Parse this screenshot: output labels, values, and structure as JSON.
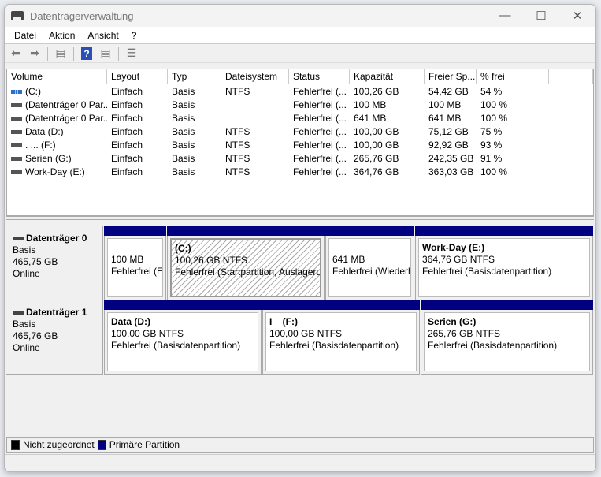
{
  "window": {
    "title": "Datenträgerverwaltung"
  },
  "menu": [
    "Datei",
    "Aktion",
    "Ansicht",
    "?"
  ],
  "toolbar": {
    "icons": [
      "back-arrow-icon",
      "forward-arrow-icon",
      "console-tree-icon",
      "help-icon",
      "action-pane-icon",
      "properties-icon"
    ]
  },
  "table": {
    "columns": [
      "Volume",
      "Layout",
      "Typ",
      "Dateisystem",
      "Status",
      "Kapazität",
      "Freier Sp...",
      "% frei",
      ""
    ],
    "rows": [
      {
        "icon": "c",
        "cells": [
          "(C:)",
          "Einfach",
          "Basis",
          "NTFS",
          "Fehlerfrei (...",
          "100,26 GB",
          "54,42 GB",
          "54 %"
        ]
      },
      {
        "icon": "d",
        "cells": [
          "(Datenträger 0 Par...",
          "Einfach",
          "Basis",
          "",
          "Fehlerfrei (...",
          "100 MB",
          "100 MB",
          "100 %"
        ]
      },
      {
        "icon": "d",
        "cells": [
          "(Datenträger 0 Par...",
          "Einfach",
          "Basis",
          "",
          "Fehlerfrei (...",
          "641 MB",
          "641 MB",
          "100 %"
        ]
      },
      {
        "icon": "d",
        "cells": [
          "Data (D:)",
          "Einfach",
          "Basis",
          "NTFS",
          "Fehlerfrei (...",
          "100,00 GB",
          "75,12 GB",
          "75 %"
        ]
      },
      {
        "icon": "d",
        "cells": [
          ". ...        (F:)",
          "Einfach",
          "Basis",
          "NTFS",
          "Fehlerfrei (...",
          "100,00 GB",
          "92,92 GB",
          "93 %"
        ]
      },
      {
        "icon": "d",
        "cells": [
          "Serien (G:)",
          "Einfach",
          "Basis",
          "NTFS",
          "Fehlerfrei (...",
          "265,76 GB",
          "242,35 GB",
          "91 %"
        ]
      },
      {
        "icon": "d",
        "cells": [
          "Work-Day (E:)",
          "Einfach",
          "Basis",
          "NTFS",
          "Fehlerfrei (...",
          "364,76 GB",
          "363,03 GB",
          "100 %"
        ]
      }
    ]
  },
  "disks": [
    {
      "name": "Datenträger 0",
      "type": "Basis",
      "size": "465,75 GB",
      "state": "Online",
      "partitions": [
        {
          "title": "",
          "size": "100 MB",
          "status": "Fehlerfrei (EFI-Systempartition)"
        },
        {
          "title": "(C:)",
          "size": "100,26 GB NTFS",
          "status": "Fehlerfrei (Startpartition, Auslagerungsdatei)",
          "selected": true
        },
        {
          "title": "",
          "size": "641 MB",
          "status": "Fehlerfrei (Wiederherstellungspartition)"
        },
        {
          "title": "Work-Day  (E:)",
          "size": "364,76 GB NTFS",
          "status": "Fehlerfrei (Basisdatenpartition)"
        }
      ]
    },
    {
      "name": "Datenträger 1",
      "type": "Basis",
      "size": "465,76 GB",
      "state": "Online",
      "partitions": [
        {
          "title": "Data  (D:)",
          "size": "100,00 GB NTFS",
          "status": "Fehlerfrei (Basisdatenpartition)"
        },
        {
          "title": "I      _  (F:)",
          "size": "100,00 GB NTFS",
          "status": "Fehlerfrei (Basisdatenpartition)"
        },
        {
          "title": "Serien  (G:)",
          "size": "265,76 GB NTFS",
          "status": "Fehlerfrei (Basisdatenpartition)"
        }
      ]
    }
  ],
  "legend": [
    {
      "label": "Nicht zugeordnet",
      "color": "#000000"
    },
    {
      "label": "Primäre Partition",
      "color": "#000080"
    }
  ]
}
